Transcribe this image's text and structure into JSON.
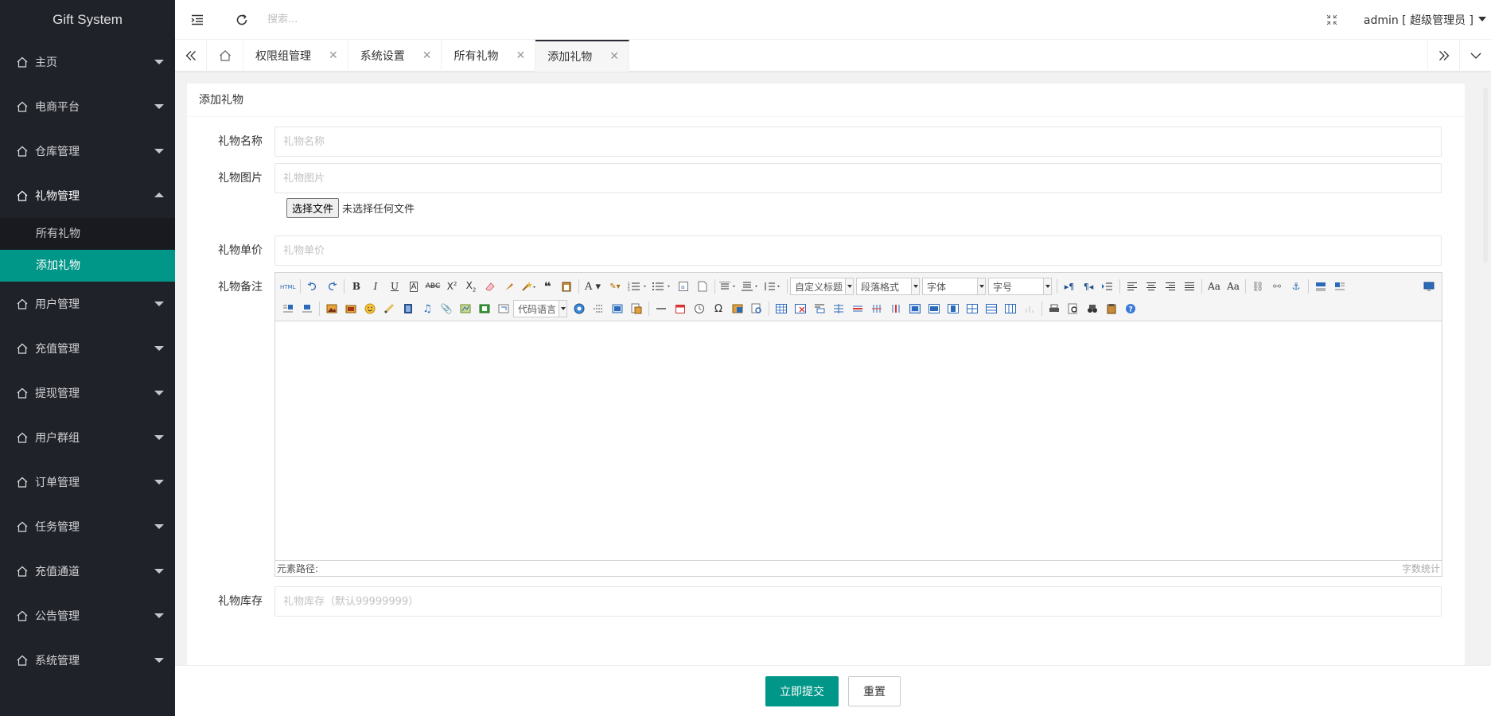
{
  "app": {
    "title": "Gift System"
  },
  "sidebar": {
    "items": [
      {
        "label": "主页"
      },
      {
        "label": "电商平台"
      },
      {
        "label": "仓库管理"
      },
      {
        "label": "礼物管理",
        "open": true,
        "children": [
          {
            "label": "所有礼物"
          },
          {
            "label": "添加礼物",
            "active": true
          }
        ]
      },
      {
        "label": "用户管理"
      },
      {
        "label": "充值管理"
      },
      {
        "label": "提现管理"
      },
      {
        "label": "用户群组"
      },
      {
        "label": "订单管理"
      },
      {
        "label": "任务管理"
      },
      {
        "label": "充值通道"
      },
      {
        "label": "公告管理"
      },
      {
        "label": "系统管理"
      }
    ]
  },
  "header": {
    "search_placeholder": "搜索...",
    "user": "admin [ 超级管理员 ]"
  },
  "tabs": [
    {
      "label": "权限组管理"
    },
    {
      "label": "系统设置"
    },
    {
      "label": "所有礼物"
    },
    {
      "label": "添加礼物",
      "active": true
    }
  ],
  "card": {
    "title": "添加礼物"
  },
  "form": {
    "name": {
      "label": "礼物名称",
      "placeholder": "礼物名称"
    },
    "image": {
      "label": "礼物图片",
      "placeholder": "礼物图片",
      "file_button": "选择文件",
      "file_status": "未选择任何文件"
    },
    "price": {
      "label": "礼物单价",
      "placeholder": "礼物单价"
    },
    "remark": {
      "label": "礼物备注"
    },
    "stock": {
      "label": "礼物库存",
      "placeholder": "礼物库存（默认99999999）"
    }
  },
  "editor": {
    "selects": {
      "heading": "自定义标题",
      "paragraph": "段落格式",
      "font": "字体",
      "size": "字号",
      "code": "代码语言"
    },
    "footer_path": "元素路径:",
    "footer_count": "字数统计"
  },
  "actions": {
    "submit": "立即提交",
    "reset": "重置"
  },
  "colors": {
    "sidebar_bg": "#20222a",
    "accent": "#009688"
  }
}
